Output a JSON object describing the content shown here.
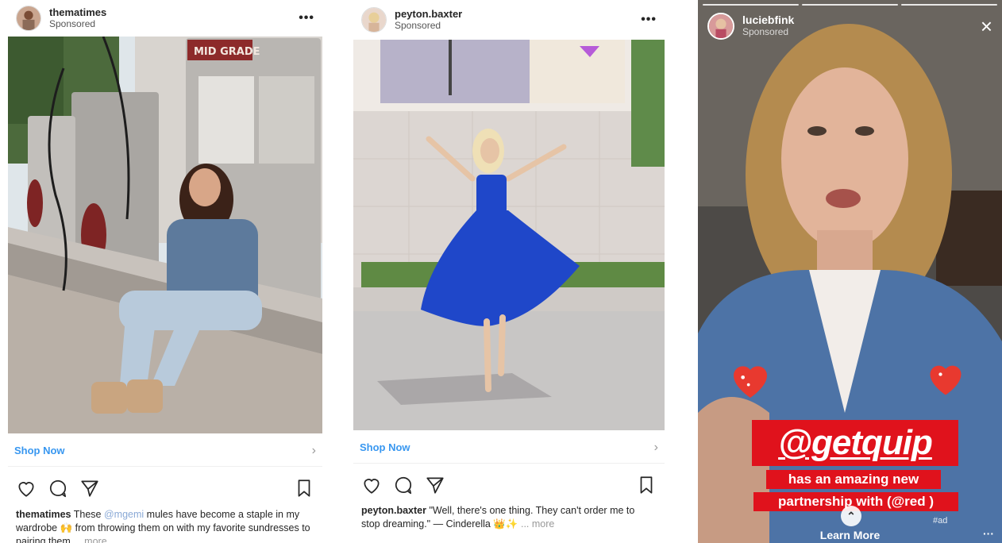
{
  "posts": [
    {
      "username": "thematimes",
      "sponsored": "Sponsored",
      "more_icon": "more-horizontal-icon",
      "cta": "Shop Now",
      "caption": {
        "user": "thematimes",
        "text_a": "These",
        "mention": "@mgemi",
        "text_b": "mules have become a staple in my wardrobe",
        "emoji": "🙌",
        "text_c": "from throwing them on with my favorite sundresses to pairing them ...",
        "more": "more"
      }
    },
    {
      "username": "peyton.baxter",
      "sponsored": "Sponsored",
      "more_icon": "more-horizontal-icon",
      "cta": "Shop Now",
      "caption": {
        "user": "peyton.baxter",
        "text": "\"Well, there's one thing. They can't order me to stop dreaming.\" — Cinderella",
        "emoji": "👑✨",
        "more": "... more"
      }
    }
  ],
  "story": {
    "username": "luciebfink",
    "sponsored": "Sponsored",
    "close_icon": "close-icon",
    "sticker_handle": "@getquip",
    "sticker_line1": "has an amazing new",
    "sticker_line2": "partnership with (@red )",
    "hashtag": "#ad",
    "learn_more": "Learn More",
    "swipe_icon": "chevron-up-icon",
    "dots": "···"
  },
  "icons": {
    "like": "heart-outline-icon",
    "comment": "comment-bubble-icon",
    "share": "paper-plane-icon",
    "save": "bookmark-icon"
  },
  "colors": {
    "link_blue": "#3897f0",
    "mention_blue": "#8aa9d6",
    "sticker_red": "#e0121c",
    "dress_blue": "#1f47c9"
  }
}
